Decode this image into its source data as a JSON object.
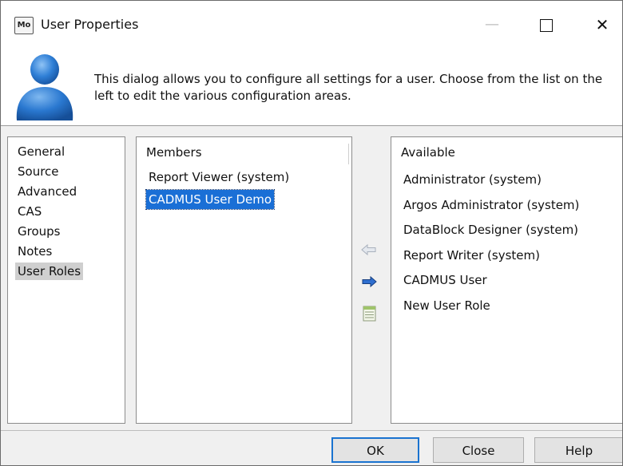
{
  "window": {
    "app_icon_text": "Mo",
    "title": "User Properties",
    "controls": {
      "minimize": "—",
      "close": "✕"
    }
  },
  "header": {
    "description": "This dialog allows you to configure all settings for a user.  Choose from the list on the left to edit the various configuration areas."
  },
  "nav": {
    "items": [
      {
        "label": "General",
        "selected": false
      },
      {
        "label": "Source",
        "selected": false
      },
      {
        "label": "Advanced",
        "selected": false
      },
      {
        "label": "CAS",
        "selected": false
      },
      {
        "label": "Groups",
        "selected": false
      },
      {
        "label": "Notes",
        "selected": false
      },
      {
        "label": "User Roles",
        "selected": true
      }
    ]
  },
  "members": {
    "header": "Members",
    "items": [
      {
        "label": "Report Viewer (system)",
        "selected": false
      },
      {
        "label": "CADMUS User Demo",
        "selected": true
      }
    ]
  },
  "available": {
    "header": "Available",
    "items": [
      {
        "label": "Administrator (system)"
      },
      {
        "label": "Argos Administrator (system)"
      },
      {
        "label": "DataBlock Designer (system)"
      },
      {
        "label": "Report Writer (system)"
      },
      {
        "label": "CADMUS User"
      },
      {
        "label": "New User Role"
      }
    ]
  },
  "transfer_buttons": {
    "icons": [
      "arrow-left-icon",
      "arrow-right-icon",
      "list-icon"
    ]
  },
  "footer": {
    "ok_label": "OK",
    "close_label": "Close",
    "help_label": "Help"
  },
  "colors": {
    "selection_blue": "#1a6fd6",
    "nav_selected_gray": "#cfcfcf",
    "arrow_blue": "#1f5fbf",
    "ok_border": "#1a73d0"
  }
}
